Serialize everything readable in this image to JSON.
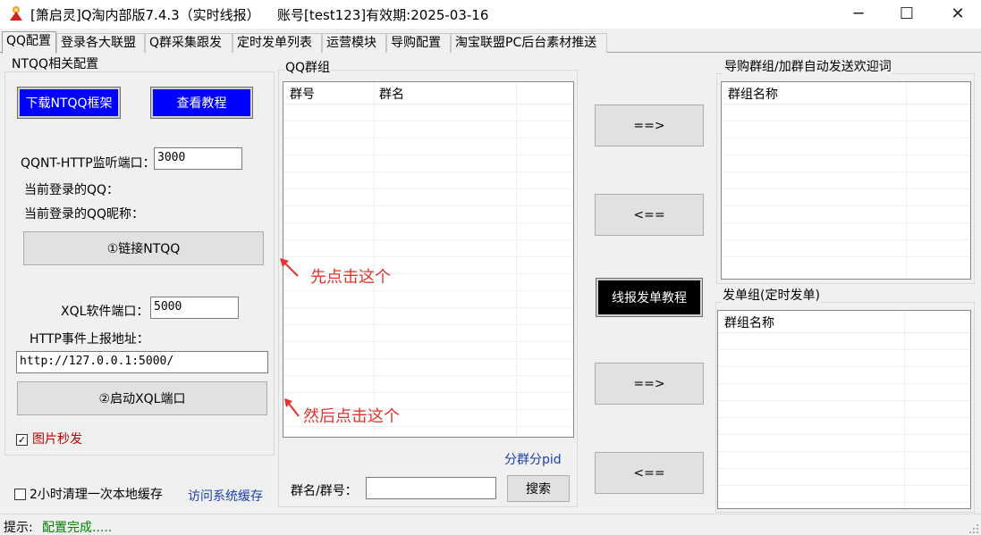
{
  "window": {
    "title": "[箫启灵]Q淘内部版7.4.3（实时线报）",
    "account": "账号[test123]有效期:2025-03-16",
    "minimize_glyph": "─",
    "maximize_glyph": "☐",
    "close_glyph": "✕"
  },
  "tabs": [
    {
      "label": "QQ配置"
    },
    {
      "label": "登录各大联盟"
    },
    {
      "label": "Q群采集跟发"
    },
    {
      "label": "定时发单列表"
    },
    {
      "label": "运营模块"
    },
    {
      "label": "导购配置"
    },
    {
      "label": "淘宝联盟PC后台素材推送"
    }
  ],
  "ntqq": {
    "group_title": "NTQQ相关配置",
    "download_button": "下载NTQQ框架",
    "tutorial_button": "查看教程",
    "http_port_label": "QQNT-HTTP监听端口：",
    "http_port_value": "3000",
    "current_qq_label": "当前登录的QQ：",
    "current_nick_label": "当前登录的QQ昵称：",
    "link_button": "①链接NTQQ",
    "xql_port_label": "XQL软件端口：",
    "xql_port_value": "5000",
    "http_event_label": "HTTP事件上报地址：",
    "http_event_value": "http://127.0.0.1:5000/",
    "start_xql_button": "②启动XQL端口",
    "image_second_label": "图片秒发",
    "image_second_checked": true
  },
  "cache": {
    "clear_label": "2小时清理一次本地缓存",
    "clear_checked": false,
    "visit_link": "访问系统缓存"
  },
  "qq_groups": {
    "group_title": "QQ群组",
    "columns": [
      "群号",
      "群名"
    ],
    "split_link": "分群分pid",
    "search_label": "群名/群号：",
    "search_value": "",
    "search_button": "搜索"
  },
  "annotations": {
    "first": "先点击这个",
    "second": "然后点击这个"
  },
  "transfer": {
    "add_top": "==>",
    "remove_top": "<==",
    "tutorial": "线报发单教程",
    "add_bottom": "==>",
    "remove_bottom": "<=="
  },
  "guide_groups": {
    "group_title": "导购群组/加群自动发送欢迎词",
    "columns": [
      "群组名称"
    ]
  },
  "send_groups": {
    "group_title": "发单组(定时发单)",
    "columns": [
      "群组名称"
    ]
  },
  "status": {
    "label": "提示:",
    "message": "配置完成.....",
    "message_color": "#008000"
  }
}
